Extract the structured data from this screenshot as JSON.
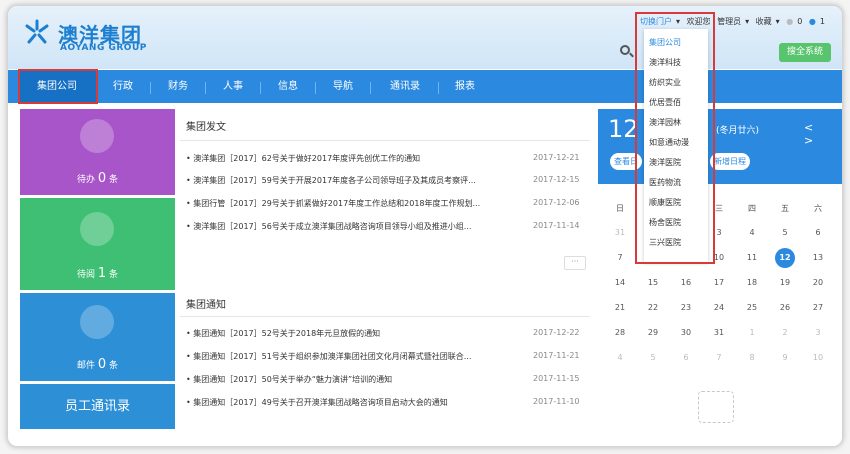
{
  "logo": {
    "cn": "澳洋集团",
    "en": "AOYANG GROUP"
  },
  "topbar": {
    "portal": "切换门户",
    "welcome": "欢迎您",
    "user": "管理员",
    "favorites": "收藏",
    "count1": "0",
    "count2": "1"
  },
  "search": {
    "placeholder": "",
    "partial": "检",
    "button": "搜全系统"
  },
  "nav": [
    "集团公司",
    "行政",
    "财务",
    "人事",
    "信息",
    "导航",
    "通讯录",
    "报表"
  ],
  "tiles": {
    "todo": {
      "label": "待办",
      "count": "0",
      "unit": "条"
    },
    "read": {
      "label": "待阅",
      "count": "1",
      "unit": "条"
    },
    "mail": {
      "label": "邮件",
      "count": "0",
      "unit": "条"
    },
    "contacts": "员工通讯录"
  },
  "panel1": {
    "title": "集团发文",
    "rows": [
      {
        "t": "澳洋集团［2017］62号关于做好2017年度评先创优工作的通知",
        "d": "2017-12-21"
      },
      {
        "t": "澳洋集团［2017］59号关于开展2017年度各子公司领导班子及其成员考察评...",
        "d": "2017-12-15"
      },
      {
        "t": "集团行管［2017］29号关于抓紧做好2017年度工作总结和2018年度工作规划...",
        "d": "2017-12-06"
      },
      {
        "t": "澳洋集团［2017］56号关于成立澳洋集团战略咨询项目领导小组及推进小组...",
        "d": "2017-11-14"
      }
    ]
  },
  "panel2": {
    "title": "集团通知",
    "rows": [
      {
        "t": "集团通知［2017］52号关于2018年元旦放假的通知",
        "d": "2017-12-22"
      },
      {
        "t": "集团通知［2017］51号关于组织参加澳洋集团社团文化月闭幕式暨社团联合...",
        "d": "2017-11-21"
      },
      {
        "t": "集团通知［2017］50号关于举办“魅力演讲”培训的通知",
        "d": "2017-11-15"
      },
      {
        "t": "集团通知［2017］49号关于召开澳洋集团战略咨询项目启动大会的通知",
        "d": "2017-11-10"
      }
    ]
  },
  "more": "···",
  "calendar": {
    "day": "12",
    "lunar": "(冬月廿六)",
    "btn_view": "查看日",
    "btn_new": "新增日程",
    "arrows": "< >",
    "weekdays": [
      "日",
      "一",
      "二",
      "三",
      "四",
      "五",
      "六"
    ],
    "rows": [
      [
        "31",
        "1",
        "2",
        "3",
        "4",
        "5",
        "6"
      ],
      [
        "7",
        "8",
        "9",
        "10",
        "11",
        "12",
        "13"
      ],
      [
        "14",
        "15",
        "16",
        "17",
        "18",
        "19",
        "20"
      ],
      [
        "21",
        "22",
        "23",
        "24",
        "25",
        "26",
        "27"
      ],
      [
        "28",
        "29",
        "30",
        "31",
        "1",
        "2",
        "3"
      ],
      [
        "4",
        "5",
        "6",
        "7",
        "8",
        "9",
        "10"
      ]
    ],
    "today": "12"
  },
  "dropdown": [
    "集团公司",
    "澳洋科技",
    "纺织实业",
    "优居壹佰",
    "澳洋园林",
    "如意通动漫",
    "澳洋医院",
    "医药物流",
    "顺康医院",
    "杨舍医院",
    "三兴医院"
  ],
  "colors": {
    "accent": "#2b8ae0",
    "todo": "#a855c9",
    "read": "#3fbf73",
    "mail": "#2d8fd6",
    "highlight": "#d83a3a"
  }
}
